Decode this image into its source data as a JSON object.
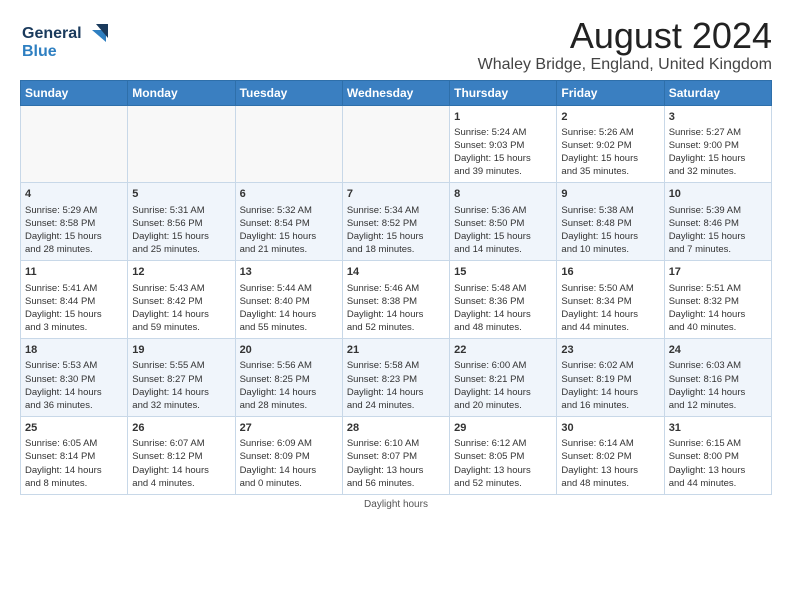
{
  "logo": {
    "text_general": "General",
    "text_blue": "Blue"
  },
  "title": "August 2024",
  "subtitle": "Whaley Bridge, England, United Kingdom",
  "days_of_week": [
    "Sunday",
    "Monday",
    "Tuesday",
    "Wednesday",
    "Thursday",
    "Friday",
    "Saturday"
  ],
  "footer": "Daylight hours",
  "weeks": [
    [
      {
        "day": "",
        "info": ""
      },
      {
        "day": "",
        "info": ""
      },
      {
        "day": "",
        "info": ""
      },
      {
        "day": "",
        "info": ""
      },
      {
        "day": "1",
        "info": "Sunrise: 5:24 AM\nSunset: 9:03 PM\nDaylight: 15 hours\nand 39 minutes."
      },
      {
        "day": "2",
        "info": "Sunrise: 5:26 AM\nSunset: 9:02 PM\nDaylight: 15 hours\nand 35 minutes."
      },
      {
        "day": "3",
        "info": "Sunrise: 5:27 AM\nSunset: 9:00 PM\nDaylight: 15 hours\nand 32 minutes."
      }
    ],
    [
      {
        "day": "4",
        "info": "Sunrise: 5:29 AM\nSunset: 8:58 PM\nDaylight: 15 hours\nand 28 minutes."
      },
      {
        "day": "5",
        "info": "Sunrise: 5:31 AM\nSunset: 8:56 PM\nDaylight: 15 hours\nand 25 minutes."
      },
      {
        "day": "6",
        "info": "Sunrise: 5:32 AM\nSunset: 8:54 PM\nDaylight: 15 hours\nand 21 minutes."
      },
      {
        "day": "7",
        "info": "Sunrise: 5:34 AM\nSunset: 8:52 PM\nDaylight: 15 hours\nand 18 minutes."
      },
      {
        "day": "8",
        "info": "Sunrise: 5:36 AM\nSunset: 8:50 PM\nDaylight: 15 hours\nand 14 minutes."
      },
      {
        "day": "9",
        "info": "Sunrise: 5:38 AM\nSunset: 8:48 PM\nDaylight: 15 hours\nand 10 minutes."
      },
      {
        "day": "10",
        "info": "Sunrise: 5:39 AM\nSunset: 8:46 PM\nDaylight: 15 hours\nand 7 minutes."
      }
    ],
    [
      {
        "day": "11",
        "info": "Sunrise: 5:41 AM\nSunset: 8:44 PM\nDaylight: 15 hours\nand 3 minutes."
      },
      {
        "day": "12",
        "info": "Sunrise: 5:43 AM\nSunset: 8:42 PM\nDaylight: 14 hours\nand 59 minutes."
      },
      {
        "day": "13",
        "info": "Sunrise: 5:44 AM\nSunset: 8:40 PM\nDaylight: 14 hours\nand 55 minutes."
      },
      {
        "day": "14",
        "info": "Sunrise: 5:46 AM\nSunset: 8:38 PM\nDaylight: 14 hours\nand 52 minutes."
      },
      {
        "day": "15",
        "info": "Sunrise: 5:48 AM\nSunset: 8:36 PM\nDaylight: 14 hours\nand 48 minutes."
      },
      {
        "day": "16",
        "info": "Sunrise: 5:50 AM\nSunset: 8:34 PM\nDaylight: 14 hours\nand 44 minutes."
      },
      {
        "day": "17",
        "info": "Sunrise: 5:51 AM\nSunset: 8:32 PM\nDaylight: 14 hours\nand 40 minutes."
      }
    ],
    [
      {
        "day": "18",
        "info": "Sunrise: 5:53 AM\nSunset: 8:30 PM\nDaylight: 14 hours\nand 36 minutes."
      },
      {
        "day": "19",
        "info": "Sunrise: 5:55 AM\nSunset: 8:27 PM\nDaylight: 14 hours\nand 32 minutes."
      },
      {
        "day": "20",
        "info": "Sunrise: 5:56 AM\nSunset: 8:25 PM\nDaylight: 14 hours\nand 28 minutes."
      },
      {
        "day": "21",
        "info": "Sunrise: 5:58 AM\nSunset: 8:23 PM\nDaylight: 14 hours\nand 24 minutes."
      },
      {
        "day": "22",
        "info": "Sunrise: 6:00 AM\nSunset: 8:21 PM\nDaylight: 14 hours\nand 20 minutes."
      },
      {
        "day": "23",
        "info": "Sunrise: 6:02 AM\nSunset: 8:19 PM\nDaylight: 14 hours\nand 16 minutes."
      },
      {
        "day": "24",
        "info": "Sunrise: 6:03 AM\nSunset: 8:16 PM\nDaylight: 14 hours\nand 12 minutes."
      }
    ],
    [
      {
        "day": "25",
        "info": "Sunrise: 6:05 AM\nSunset: 8:14 PM\nDaylight: 14 hours\nand 8 minutes."
      },
      {
        "day": "26",
        "info": "Sunrise: 6:07 AM\nSunset: 8:12 PM\nDaylight: 14 hours\nand 4 minutes."
      },
      {
        "day": "27",
        "info": "Sunrise: 6:09 AM\nSunset: 8:09 PM\nDaylight: 14 hours\nand 0 minutes."
      },
      {
        "day": "28",
        "info": "Sunrise: 6:10 AM\nSunset: 8:07 PM\nDaylight: 13 hours\nand 56 minutes."
      },
      {
        "day": "29",
        "info": "Sunrise: 6:12 AM\nSunset: 8:05 PM\nDaylight: 13 hours\nand 52 minutes."
      },
      {
        "day": "30",
        "info": "Sunrise: 6:14 AM\nSunset: 8:02 PM\nDaylight: 13 hours\nand 48 minutes."
      },
      {
        "day": "31",
        "info": "Sunrise: 6:15 AM\nSunset: 8:00 PM\nDaylight: 13 hours\nand 44 minutes."
      }
    ]
  ]
}
